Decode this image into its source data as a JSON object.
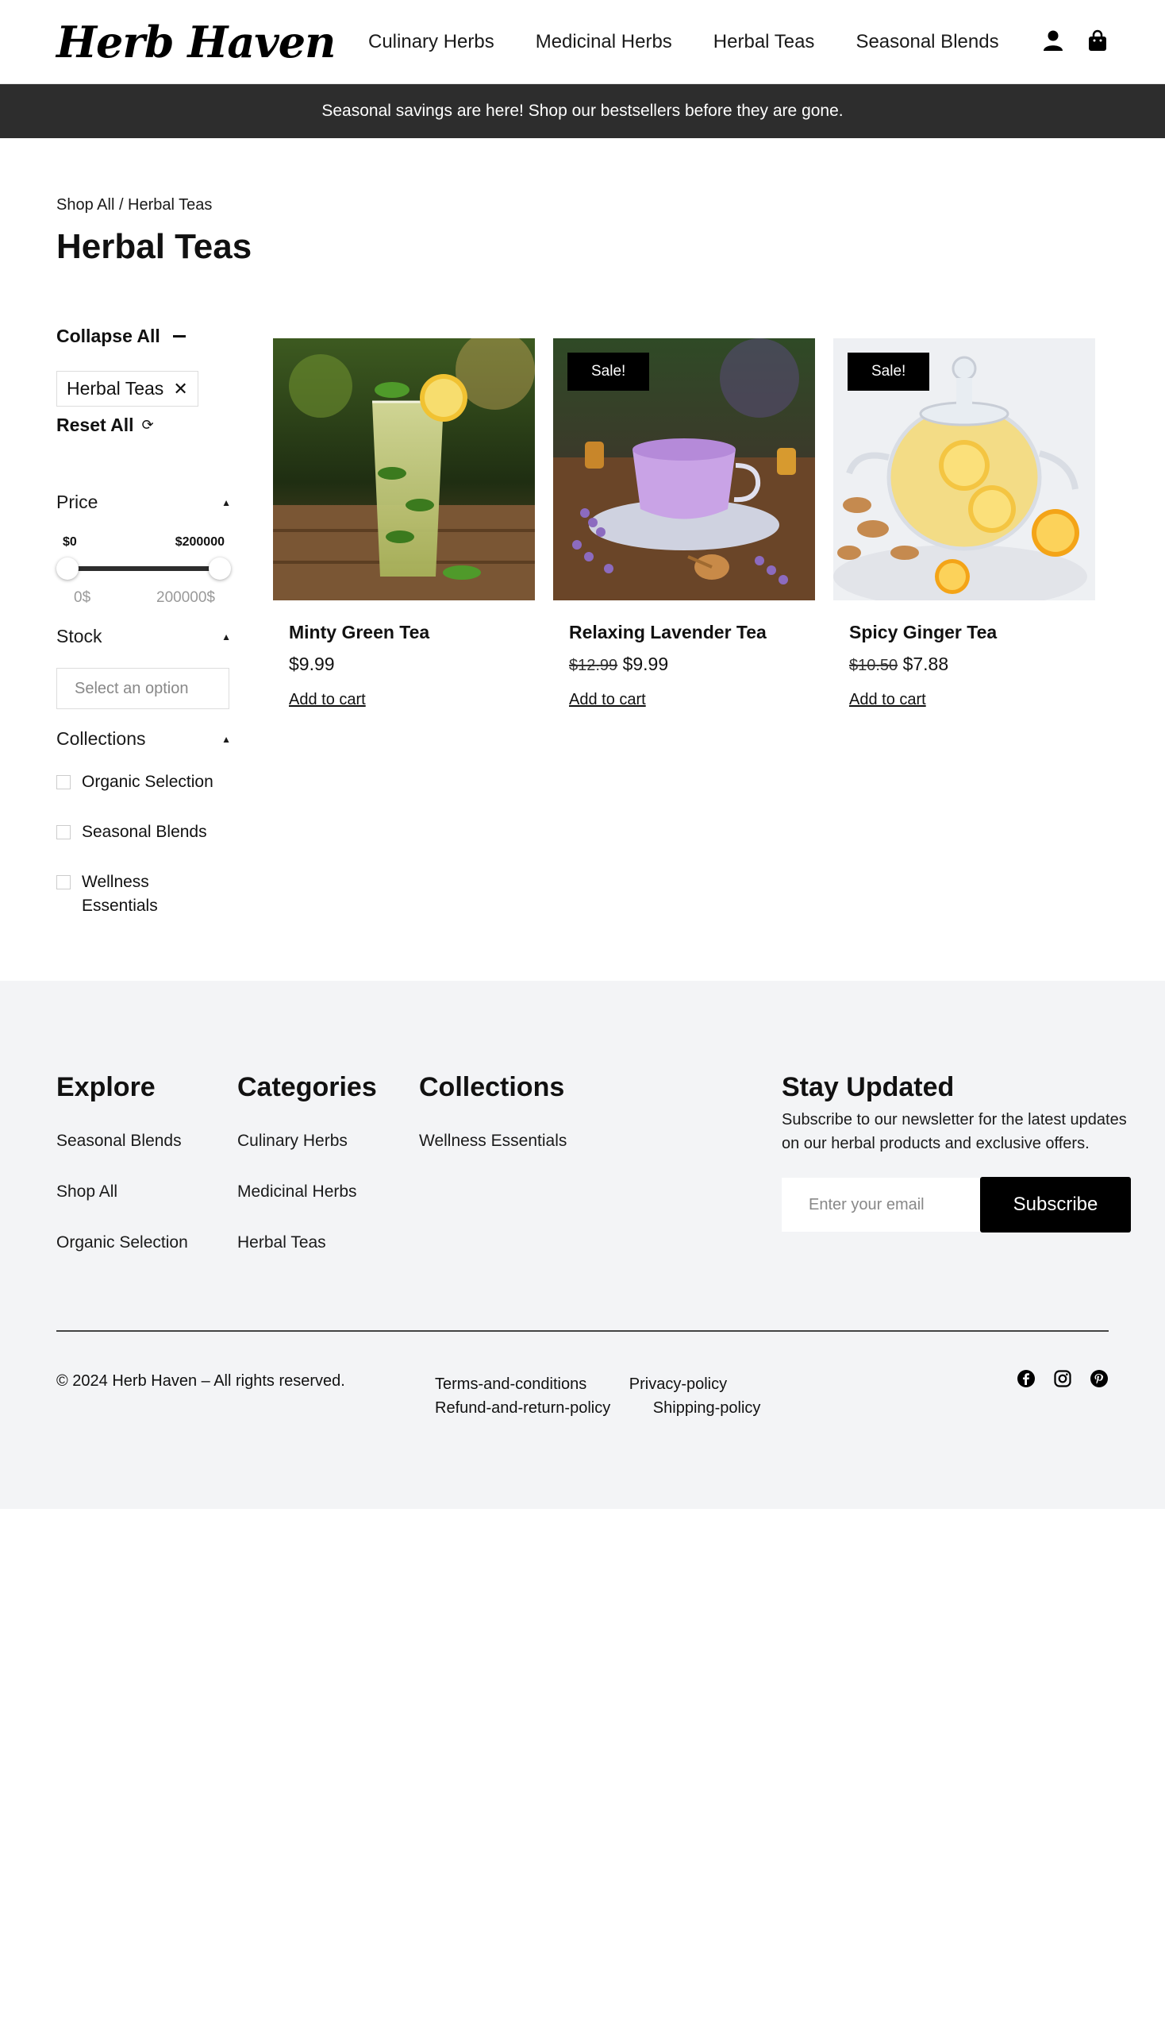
{
  "header": {
    "logo": "Herb Haven",
    "nav": [
      "Culinary Herbs",
      "Medicinal Herbs",
      "Herbal Teas",
      "Seasonal Blends"
    ],
    "icons": [
      "account-icon",
      "bag-icon"
    ]
  },
  "announcement": "Seasonal savings are here! Shop our bestsellers before they are gone.",
  "breadcrumb": "Shop All / Herbal Teas",
  "page_title": "Herbal Teas",
  "filters": {
    "collapse_all": "Collapse All",
    "active_chip": "Herbal Teas",
    "reset_all": "Reset All",
    "price": {
      "label": "Price",
      "min_label": "$0",
      "max_label": "$200000",
      "min_value": "0$",
      "max_value": "200000$"
    },
    "stock": {
      "label": "Stock",
      "placeholder": "Select an option"
    },
    "collections": {
      "label": "Collections",
      "options": [
        "Organic Selection",
        "Seasonal Blends",
        "Wellness Essentials"
      ]
    }
  },
  "products": [
    {
      "name": "Minty Green Tea",
      "old_price": "",
      "price": "$9.99",
      "sale": "",
      "cart": "Add to cart"
    },
    {
      "name": "Relaxing Lavender Tea",
      "old_price": "$12.99",
      "price": "$9.99",
      "sale": "Sale!",
      "cart": "Add to cart"
    },
    {
      "name": "Spicy Ginger Tea",
      "old_price": "$10.50",
      "price": "$7.88",
      "sale": "Sale!",
      "cart": "Add to cart"
    }
  ],
  "footer": {
    "explore": {
      "title": "Explore",
      "links": [
        "Seasonal Blends",
        "Shop All",
        "Organic Selection"
      ]
    },
    "categories": {
      "title": "Categories",
      "links": [
        "Culinary Herbs",
        "Medicinal Herbs",
        "Herbal Teas"
      ]
    },
    "collections": {
      "title": "Collections",
      "links": [
        "Wellness Essentials"
      ]
    },
    "newsletter": {
      "title": "Stay Updated",
      "text": "Subscribe to our newsletter for the latest updates on our herbal products and exclusive offers.",
      "placeholder": "Enter your email",
      "button": "Subscribe"
    },
    "copyright": "© 2024 Herb Haven – All rights reserved.",
    "legal": [
      "Terms-and-conditions",
      "Privacy-policy",
      "Refund-and-return-policy",
      "Shipping-policy"
    ],
    "social": [
      "facebook-icon",
      "instagram-icon",
      "pinterest-icon"
    ]
  }
}
